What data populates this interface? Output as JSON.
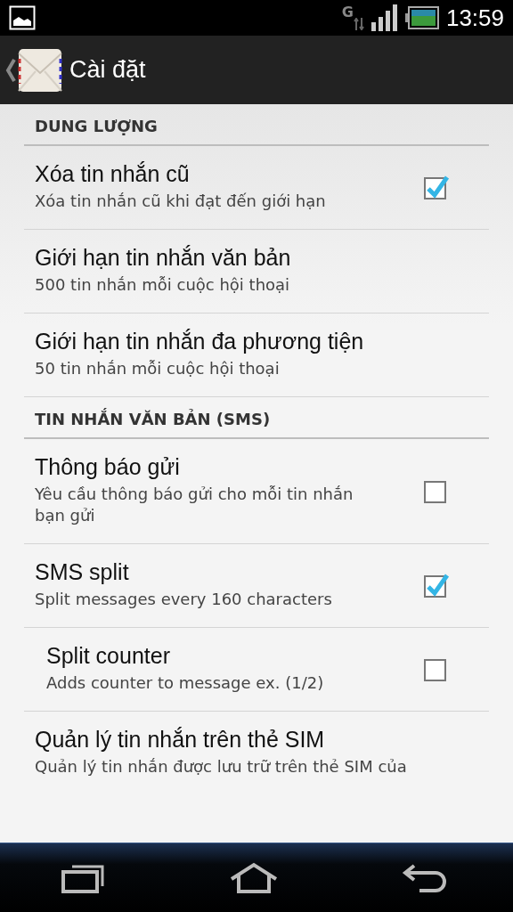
{
  "status_bar": {
    "network": "G",
    "time": "13:59"
  },
  "action_bar": {
    "title": "Cài đặt"
  },
  "sections": [
    {
      "header": "DUNG LƯỢNG",
      "items": [
        {
          "kind": "checkbox",
          "title": "Xóa tin nhắn cũ",
          "summary": "Xóa tin nhắn cũ khi đạt đến giới hạn",
          "checked": true
        },
        {
          "kind": "plain",
          "title": "Giới hạn tin nhắn văn bản",
          "summary": "500 tin nhắn mỗi cuộc hội thoại"
        },
        {
          "kind": "plain",
          "title": "Giới hạn tin nhắn đa phương tiện",
          "summary": "50 tin nhắn mỗi cuộc hội thoại"
        }
      ]
    },
    {
      "header": "TIN NHẮN VĂN BẢN (SMS)",
      "items": [
        {
          "kind": "checkbox",
          "title": "Thông báo gửi",
          "summary": "Yêu cầu thông báo gửi cho mỗi tin nhắn bạn gửi",
          "checked": false
        },
        {
          "kind": "checkbox",
          "title": "SMS split",
          "summary": "Split messages every 160 characters",
          "checked": true,
          "children": [
            {
              "kind": "checkbox",
              "title": "Split counter",
              "summary": "Adds counter to message ex. (1/2)",
              "checked": false
            }
          ]
        },
        {
          "kind": "plain",
          "title": "Quản lý tin nhắn trên thẻ SIM",
          "summary": "Quản lý tin nhắn được lưu trữ trên thẻ SIM của"
        }
      ]
    }
  ]
}
